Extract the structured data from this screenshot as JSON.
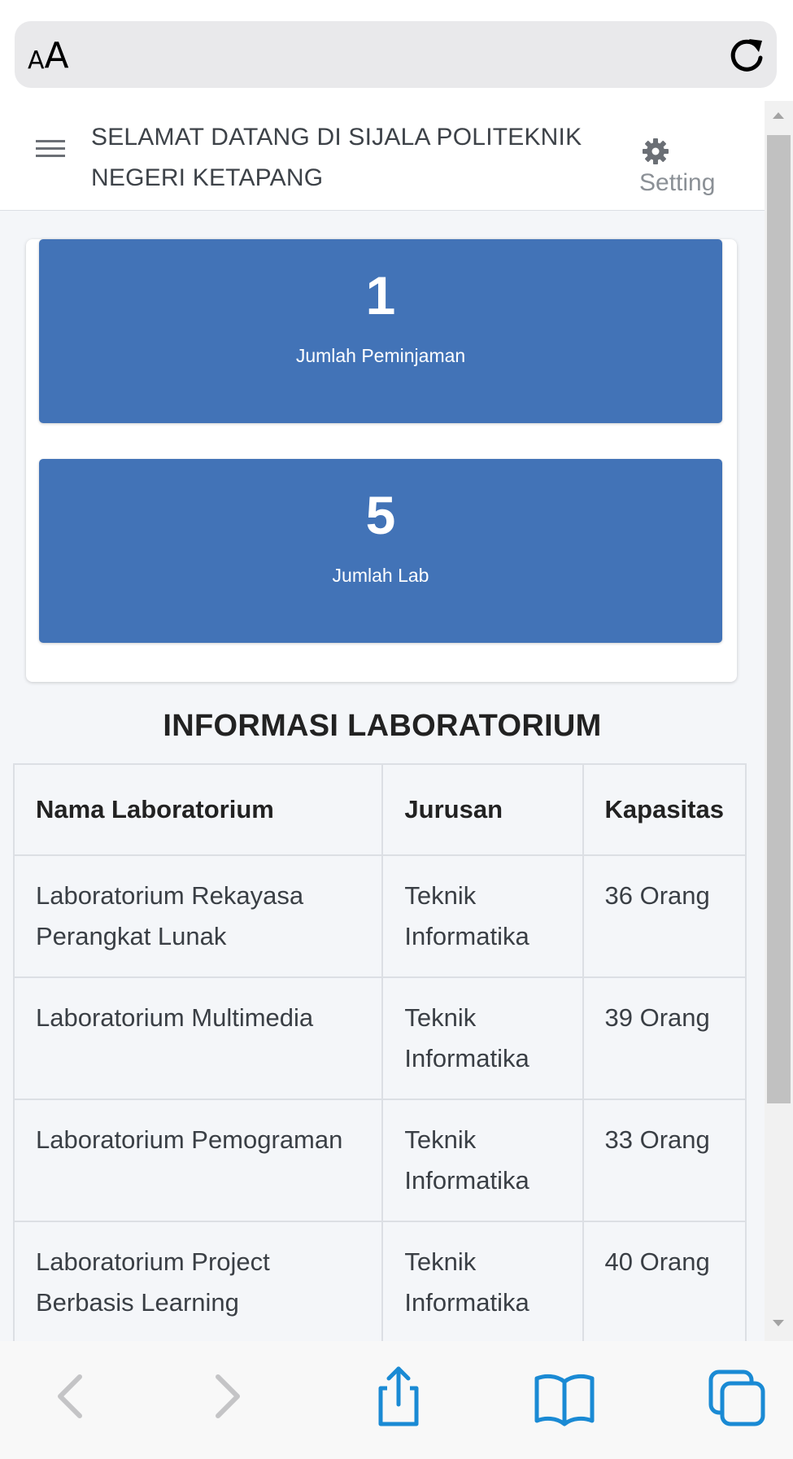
{
  "browser": {
    "text_size_small": "A",
    "text_size_big": "A",
    "reload_icon": "reload-icon"
  },
  "header": {
    "title_line1": "SELAMAT DATANG DI SIJALA POLITEKNIK",
    "title_line2": "NEGERI KETAPANG",
    "menu_icon": "hamburger-menu-icon",
    "setting_icon": "gear-icon",
    "setting_label": "Setting"
  },
  "stats": [
    {
      "value": "1",
      "label": "Jumlah Peminjaman"
    },
    {
      "value": "5",
      "label": "Jumlah Lab"
    }
  ],
  "colors": {
    "accent": "#4273b7",
    "page_background": "#f4f6f9",
    "ios_blue": "#1a8ad4"
  },
  "lab_section": {
    "title": "INFORMASI LABORATORIUM",
    "columns": [
      "Nama Laboratorium",
      "Jurusan",
      "Kapasitas"
    ],
    "rows": [
      {
        "name_line1": "Laboratorium Rekayasa",
        "name_line2": "Perangkat Lunak",
        "dept_line1": "Teknik",
        "dept_line2": "Informatika",
        "capacity": "36 Orang"
      },
      {
        "name_line1": "Laboratorium Multimedia",
        "name_line2": "",
        "dept_line1": "Teknik",
        "dept_line2": "Informatika",
        "capacity": "39 Orang"
      },
      {
        "name_line1": "Laboratorium Pemograman",
        "name_line2": "",
        "dept_line1": "Teknik",
        "dept_line2": "Informatika",
        "capacity": "33 Orang"
      },
      {
        "name_line1": "Laboratorium Project",
        "name_line2": "Berbasis Learning",
        "dept_line1": "Teknik",
        "dept_line2": "Informatika",
        "capacity": "40 Orang"
      }
    ]
  },
  "toolbar": {
    "items": [
      "back-arrow-icon",
      "forward-arrow-icon",
      "share-icon",
      "bookmarks-icon",
      "tabs-icon"
    ]
  }
}
